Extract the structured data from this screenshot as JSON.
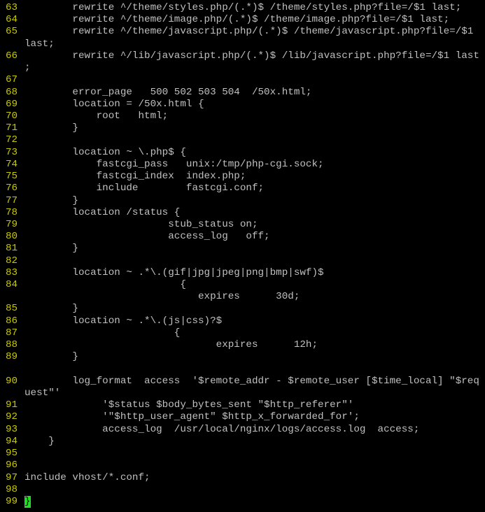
{
  "editor": {
    "line_number_color": "#c8c800",
    "text_color": "#c0c0c0",
    "cursor_color": "#22dd22",
    "rows": [
      {
        "n": "63",
        "t": "        rewrite ^/theme/styles.php/(.*)$ /theme/styles.php?file=/$1 last;"
      },
      {
        "n": "64",
        "t": "        rewrite ^/theme/image.php/(.*)$ /theme/image.php?file=/$1 last;"
      },
      {
        "n": "65",
        "t": "        rewrite ^/theme/javascript.php/(.*)$ /theme/javascript.php?file=/$1"
      },
      {
        "n": "",
        "t": "last;"
      },
      {
        "n": "66",
        "t": "        rewrite ^/lib/javascript.php/(.*)$ /lib/javascript.php?file=/$1 last"
      },
      {
        "n": "",
        "t": ";"
      },
      {
        "n": "67",
        "t": ""
      },
      {
        "n": "68",
        "t": "        error_page   500 502 503 504  /50x.html;"
      },
      {
        "n": "69",
        "t": "        location = /50x.html {"
      },
      {
        "n": "70",
        "t": "            root   html;"
      },
      {
        "n": "71",
        "t": "        }"
      },
      {
        "n": "72",
        "t": ""
      },
      {
        "n": "73",
        "t": "        location ~ \\.php$ {"
      },
      {
        "n": "74",
        "t": "            fastcgi_pass   unix:/tmp/php-cgi.sock;"
      },
      {
        "n": "75",
        "t": "            fastcgi_index  index.php;"
      },
      {
        "n": "76",
        "t": "            include        fastcgi.conf;"
      },
      {
        "n": "77",
        "t": "        }"
      },
      {
        "n": "78",
        "t": "        location /status {"
      },
      {
        "n": "79",
        "t": "                        stub_status on;"
      },
      {
        "n": "80",
        "t": "                        access_log   off;"
      },
      {
        "n": "81",
        "t": "        }"
      },
      {
        "n": "82",
        "t": ""
      },
      {
        "n": "83",
        "t": "        location ~ .*\\.(gif|jpg|jpeg|png|bmp|swf)$"
      },
      {
        "n": "84",
        "t": "                          {"
      },
      {
        "n": "",
        "t": "                             expires      30d;"
      },
      {
        "n": "85",
        "t": "        }"
      },
      {
        "n": "86",
        "t": "        location ~ .*\\.(js|css)?$"
      },
      {
        "n": "87",
        "t": "                         {"
      },
      {
        "n": "88",
        "t": "                                expires      12h;"
      },
      {
        "n": "89",
        "t": "        }"
      },
      {
        "n": "",
        "t": ""
      },
      {
        "n": "90",
        "t": "        log_format  access  '$remote_addr - $remote_user [$time_local] \"$req"
      },
      {
        "n": "",
        "t": "uest\"'"
      },
      {
        "n": "91",
        "t": "             '$status $body_bytes_sent \"$http_referer\"'"
      },
      {
        "n": "92",
        "t": "             '\"$http_user_agent\" $http_x_forwarded_for';"
      },
      {
        "n": "93",
        "t": "             access_log  /usr/local/nginx/logs/access.log  access;"
      },
      {
        "n": "94",
        "t": "    }"
      },
      {
        "n": "95",
        "t": ""
      },
      {
        "n": "96",
        "t": ""
      },
      {
        "n": "97",
        "t": "include vhost/*.conf;"
      },
      {
        "n": "98",
        "t": ""
      },
      {
        "n": "99",
        "t": "}",
        "cursor": true
      }
    ]
  }
}
